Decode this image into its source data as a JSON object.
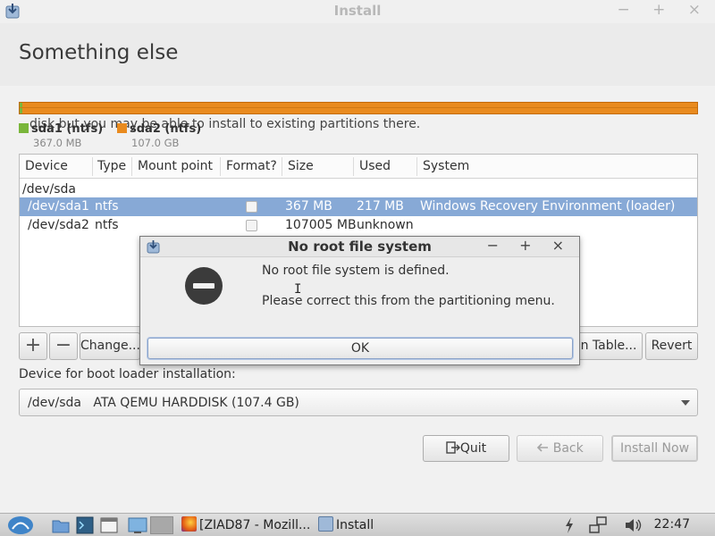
{
  "window": {
    "title": "Install",
    "controls": "− + ×"
  },
  "page": {
    "heading": "Something else"
  },
  "disk": {
    "note": "disk but you may be able to install to existing partitions there.",
    "partitions": [
      {
        "label": "sda1 (ntfs)",
        "size": "367.0 MB",
        "color": "#7ab63b"
      },
      {
        "label": "sda2 (ntfs)",
        "size": "107.0 GB",
        "color": "#e98b1f"
      }
    ]
  },
  "table": {
    "headers": [
      "Device",
      "Type",
      "Mount point",
      "Format?",
      "Size",
      "Used",
      "System"
    ],
    "group": "/dev/sda",
    "rows": [
      {
        "device": "/dev/sda1",
        "type": "ntfs",
        "mount": "",
        "size": "367 MB",
        "used": "217 MB",
        "system": "Windows Recovery Environment (loader)",
        "selected": true
      },
      {
        "device": "/dev/sda2",
        "type": "ntfs",
        "mount": "",
        "size": "107005 MB",
        "used": "unknown",
        "system": "",
        "selected": false
      }
    ]
  },
  "toolbar": {
    "add": "+",
    "remove": "−",
    "change": "Change...",
    "new_table": "on Table...",
    "revert": "Revert"
  },
  "bootloader": {
    "label": "Device for boot loader installation:",
    "value": "/dev/sda   ATA QEMU HARDDISK (107.4 GB)"
  },
  "nav": {
    "quit": "Quit",
    "back": "Back",
    "install_now": "Install Now"
  },
  "dialog": {
    "title": "No root file system",
    "controls": "− + ×",
    "message": "No root file system is defined.",
    "detail": "Please correct this from the partitioning menu.",
    "ok": "OK"
  },
  "taskbar": {
    "task1": "[ZIAD87 - Mozill...",
    "task2": "Install",
    "clock": "22:47"
  }
}
